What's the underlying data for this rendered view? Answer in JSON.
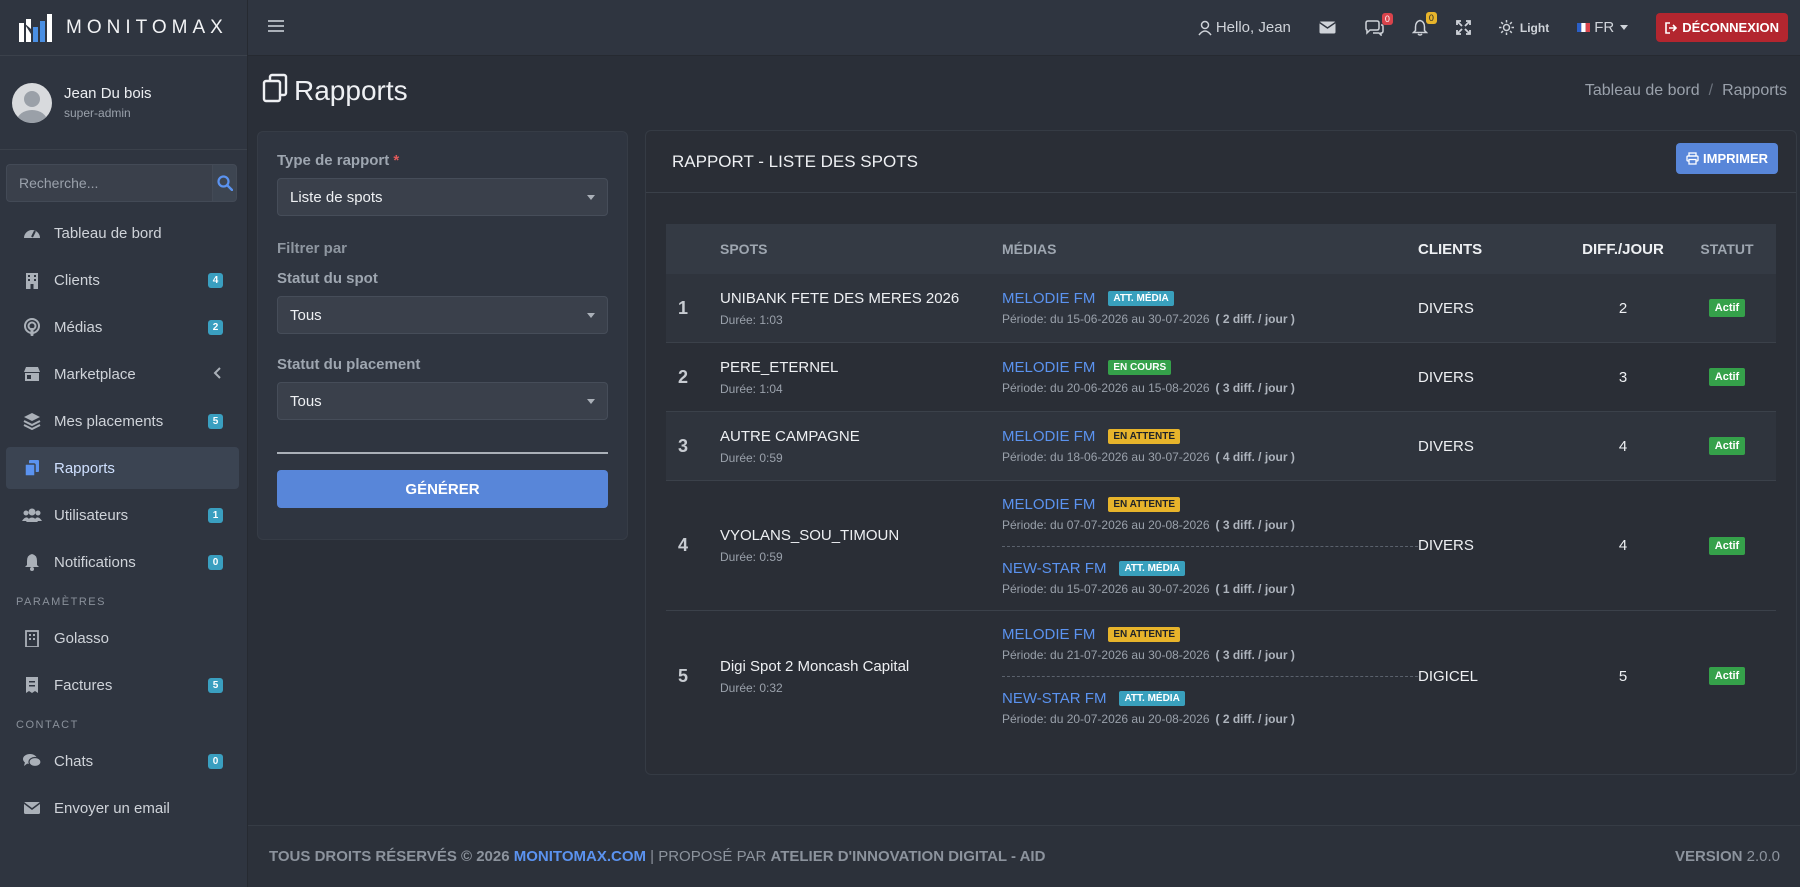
{
  "brand": {
    "name": "MONITOMAX"
  },
  "user": {
    "name": "Jean Du bois",
    "role": "super-admin"
  },
  "search": {
    "placeholder": "Recherche..."
  },
  "sidebar": {
    "items": [
      {
        "label": "Tableau de bord",
        "icon": "dashboard-icon"
      },
      {
        "label": "Clients",
        "icon": "building-icon",
        "badge": "4"
      },
      {
        "label": "Médias",
        "icon": "podcast-icon",
        "badge": "2"
      },
      {
        "label": "Marketplace",
        "icon": "store-icon"
      },
      {
        "label": "Mes placements",
        "icon": "layers-icon",
        "badge": "5"
      },
      {
        "label": "Rapports",
        "icon": "copy-icon",
        "active": true
      },
      {
        "label": "Utilisateurs",
        "icon": "users-icon",
        "badge": "1"
      },
      {
        "label": "Notifications",
        "icon": "bell-icon",
        "badge": "0"
      }
    ],
    "section_params": "PARAMÈTRES",
    "params_items": [
      {
        "label": "Golasso",
        "icon": "building-icon"
      },
      {
        "label": "Factures",
        "icon": "invoice-icon",
        "badge": "5"
      }
    ],
    "section_contact": "CONTACT",
    "contact_items": [
      {
        "label": "Chats",
        "icon": "chat-icon",
        "badge": "0"
      },
      {
        "label": "Envoyer un email",
        "icon": "envelope-icon"
      }
    ]
  },
  "topbar": {
    "greeting": "Hello, Jean",
    "chat_badge": "0",
    "bell_badge": "0",
    "theme_label": "Light",
    "lang": "FR",
    "logout": "DÉCONNEXION"
  },
  "page": {
    "title": "Rapports",
    "breadcrumb": [
      "Tableau de bord",
      "Rapports"
    ]
  },
  "filter": {
    "type_label": "Type de rapport",
    "type_value": "Liste de spots",
    "filter_by": "Filtrer par",
    "spot_status_label": "Statut du spot",
    "spot_status_value": "Tous",
    "placement_status_label": "Statut du placement",
    "placement_status_value": "Tous",
    "generate": "GÉNÉRER"
  },
  "report": {
    "title": "RAPPORT - LISTE DES SPOTS",
    "print": "IMPRIMER",
    "columns": [
      "SPOTS",
      "MÉDIAS",
      "CLIENTS",
      "DIFF./JOUR",
      "STATUT"
    ],
    "rows": [
      {
        "num": "1",
        "spot": "UNIBANK FETE DES MERES 2026",
        "duration": "Durée: 1:03",
        "client": "DIVERS",
        "diff": "2",
        "status": "Actif",
        "medias": [
          {
            "name": "MELODIE FM",
            "tag": "ATT. MÉDIA",
            "tag_type": "att",
            "period": "Période: du 15-06-2026 au 30-07-2026",
            "diff": "( 2 diff. / jour )"
          }
        ]
      },
      {
        "num": "2",
        "spot": "PERE_ETERNEL",
        "duration": "Durée: 1:04",
        "client": "DIVERS",
        "diff": "3",
        "status": "Actif",
        "medias": [
          {
            "name": "MELODIE FM",
            "tag": "EN COURS",
            "tag_type": "cours",
            "period": "Période: du 20-06-2026 au 15-08-2026",
            "diff": "( 3 diff. / jour )"
          }
        ]
      },
      {
        "num": "3",
        "spot": "AUTRE CAMPAGNE",
        "duration": "Durée: 0:59",
        "client": "DIVERS",
        "diff": "4",
        "status": "Actif",
        "medias": [
          {
            "name": "MELODIE FM",
            "tag": "EN ATTENTE",
            "tag_type": "wait",
            "period": "Période: du 18-06-2026 au 30-07-2026",
            "diff": "( 4 diff. / jour )"
          }
        ]
      },
      {
        "num": "4",
        "spot": "VYOLANS_SOU_TIMOUN",
        "duration": "Durée: 0:59",
        "client": "DIVERS",
        "diff": "4",
        "status": "Actif",
        "medias": [
          {
            "name": "MELODIE FM",
            "tag": "EN ATTENTE",
            "tag_type": "wait",
            "period": "Période: du 07-07-2026 au 20-08-2026",
            "diff": "( 3 diff. / jour )"
          },
          {
            "name": "NEW-STAR FM",
            "tag": "ATT. MÉDIA",
            "tag_type": "att",
            "period": "Période: du 15-07-2026 au 30-07-2026",
            "diff": "( 1 diff. / jour )"
          }
        ]
      },
      {
        "num": "5",
        "spot": "Digi Spot 2 Moncash Capital",
        "duration": "Durée: 0:32",
        "client": "DIGICEL",
        "diff": "5",
        "status": "Actif",
        "medias": [
          {
            "name": "MELODIE FM",
            "tag": "EN ATTENTE",
            "tag_type": "wait",
            "period": "Période: du 21-07-2026 au 30-08-2026",
            "diff": "( 3 diff. / jour )"
          },
          {
            "name": "NEW-STAR FM",
            "tag": "ATT. MÉDIA",
            "tag_type": "att",
            "period": "Période: du 20-07-2026 au 20-08-2026",
            "diff": "( 2 diff. / jour )"
          }
        ]
      }
    ]
  },
  "footer": {
    "rights": "TOUS DROITS RÉSERVÉS © 2026",
    "site": "MONITOMAX.COM",
    "proposed_by": "| PROPOSÉ PAR",
    "company": "ATELIER D'INNOVATION DIGITAL - AID",
    "version_label": "VERSION",
    "version": "2.0.0"
  },
  "colors": {
    "accent": "#5886d9",
    "link": "#5b93f0",
    "danger": "#b3262f",
    "success": "#35a14a",
    "warning": "#e7b42b",
    "info": "#39a0bd"
  }
}
